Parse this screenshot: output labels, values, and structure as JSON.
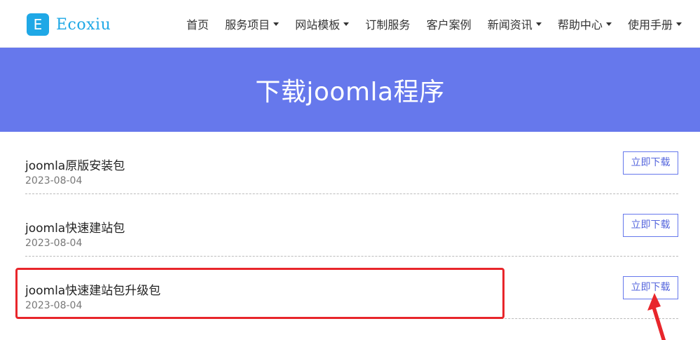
{
  "header": {
    "logo_letter": "E",
    "logo_text": "Ecoxiu",
    "nav": [
      {
        "label": "首页"
      },
      {
        "label": "服务项目"
      },
      {
        "label": "网站模板"
      },
      {
        "label": "订制服务"
      },
      {
        "label": "客户案例"
      },
      {
        "label": "新闻资讯"
      },
      {
        "label": "帮助中心"
      },
      {
        "label": "使用手册"
      }
    ]
  },
  "banner": {
    "title": "下载joomla程序"
  },
  "downloads": [
    {
      "title": "joomla原版安装包",
      "date": "2023-08-04",
      "button": "立即下载"
    },
    {
      "title": "joomla快速建站包",
      "date": "2023-08-04",
      "button": "立即下载"
    },
    {
      "title": "joomla快速建站包升级包",
      "date": "2023-08-04",
      "button": "立即下载"
    }
  ],
  "colors": {
    "brand": "#1fa8e6",
    "banner": "#6678ec",
    "annotation": "#e8262b"
  }
}
